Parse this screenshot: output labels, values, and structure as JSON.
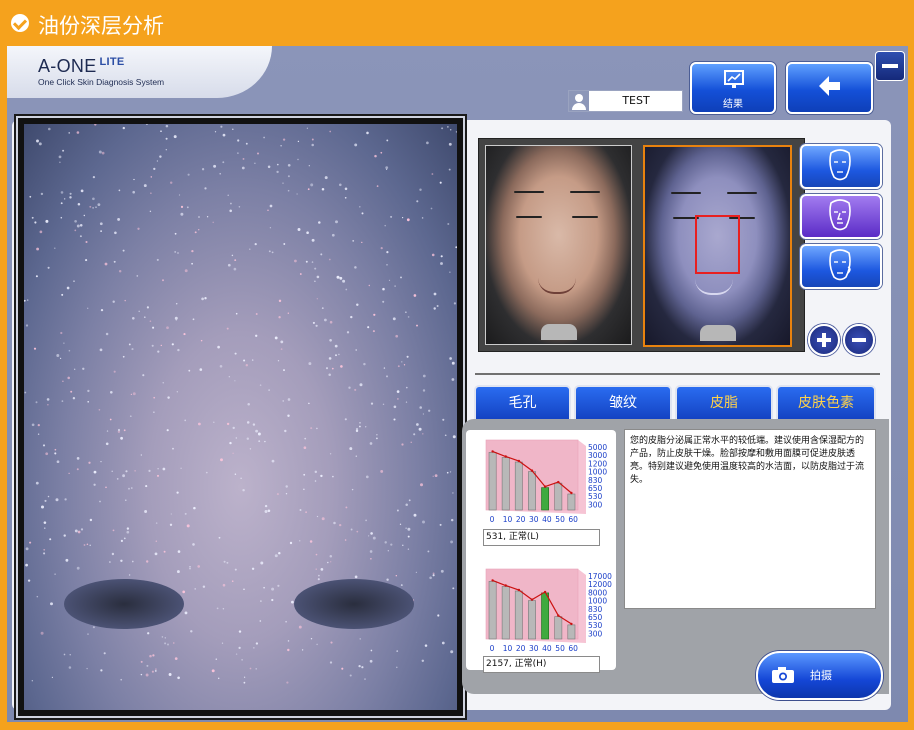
{
  "window": {
    "title": "油份深层分析"
  },
  "brand": {
    "name": "A-ONE",
    "edition": "LITE",
    "tagline": "One Click Skin Diagnosis System"
  },
  "user": {
    "name": "TEST"
  },
  "toolbar": {
    "result_label": "结果"
  },
  "tabs": [
    {
      "label": "毛孔",
      "color": "#ffffff"
    },
    {
      "label": "皱纹",
      "color": "#ffffff"
    },
    {
      "label": "皮脂",
      "color": "#ffd24a"
    },
    {
      "label": "皮肤色素",
      "color": "#ffd24a"
    }
  ],
  "analysis": {
    "description": "您的皮脂分泌属正常水平的较低端。建议使用含保湿配方的产品，防止皮肤干燥。脸部按摩和敷用面膜可促进皮肤透亮。特别建议避免使用温度较高的水洁面，以防皮脂过于流失。"
  },
  "charts": [
    {
      "x_ticks": [
        "0",
        "10",
        "20",
        "30",
        "40",
        "50",
        "60"
      ],
      "y_ticks": [
        "5000",
        "3000",
        "1200",
        "1000",
        "830",
        "650",
        "530",
        "300"
      ],
      "values": [
        0.9,
        0.82,
        0.75,
        0.6,
        0.35,
        0.42,
        0.25
      ],
      "highlight_index": 4,
      "value_label": "531, 正常(L)"
    },
    {
      "x_ticks": [
        "0",
        "10",
        "20",
        "30",
        "40",
        "50",
        "60"
      ],
      "y_ticks": [
        "17000",
        "12000",
        "8000",
        "1000",
        "830",
        "650",
        "530",
        "300"
      ],
      "values": [
        0.9,
        0.82,
        0.75,
        0.6,
        0.72,
        0.35,
        0.22
      ],
      "highlight_index": 4,
      "value_label": "2157, 正常(H)"
    }
  ],
  "capture": {
    "label": "拍摄"
  },
  "colors": {
    "title_bar": "#f5a21d",
    "button_blue": "#1450d8",
    "roi_red": "#e82020",
    "selected_frame": "#e8820e",
    "bar_green": "#3faa3f",
    "trend_red": "#cc1111"
  }
}
